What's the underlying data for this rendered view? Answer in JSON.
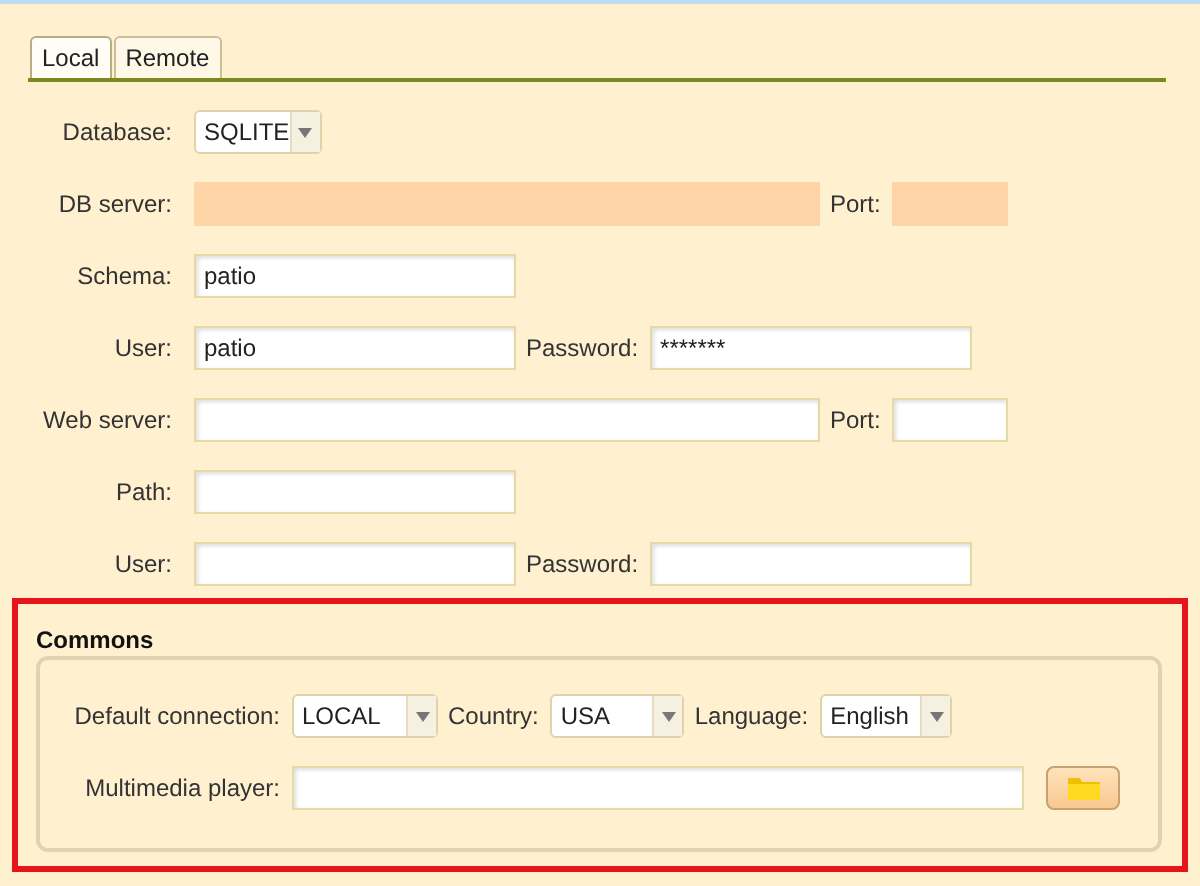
{
  "tabs": [
    {
      "label": "Local",
      "selected": true
    },
    {
      "label": "Remote",
      "selected": false
    }
  ],
  "form_rows": [
    {
      "kind": "select",
      "fields": [
        {
          "label": "Database:",
          "value": "SQLITE"
        }
      ]
    },
    {
      "kind": "server",
      "fields": [
        {
          "label": "DB server:",
          "disabled": true
        },
        {
          "label": "Port:",
          "disabled": true
        }
      ]
    },
    {
      "kind": "single",
      "fields": [
        {
          "label": "Schema:",
          "value": "patio",
          "disabled": false
        }
      ]
    },
    {
      "kind": "credentials",
      "fields": [
        {
          "label": "User:",
          "value": "patio",
          "disabled": false
        },
        {
          "label": "Password:",
          "value": "*******",
          "disabled": false
        }
      ]
    },
    {
      "kind": "server",
      "fields": [
        {
          "label": "Web server:",
          "disabled": false
        },
        {
          "label": "Port:",
          "disabled": false
        }
      ]
    },
    {
      "kind": "single",
      "fields": [
        {
          "label": "Path:",
          "disabled": false
        }
      ]
    },
    {
      "kind": "credentials",
      "fields": [
        {
          "label": "User:",
          "disabled": false
        },
        {
          "label": "Password:",
          "disabled": false
        }
      ]
    }
  ],
  "commons": {
    "title": "Commons",
    "selects": [
      {
        "label": "Default connection:",
        "value": "LOCAL"
      },
      {
        "label": "Country:",
        "value": "USA"
      },
      {
        "label": "Language:",
        "value": "English"
      }
    ],
    "player": {
      "label": "Multimedia player:"
    }
  }
}
